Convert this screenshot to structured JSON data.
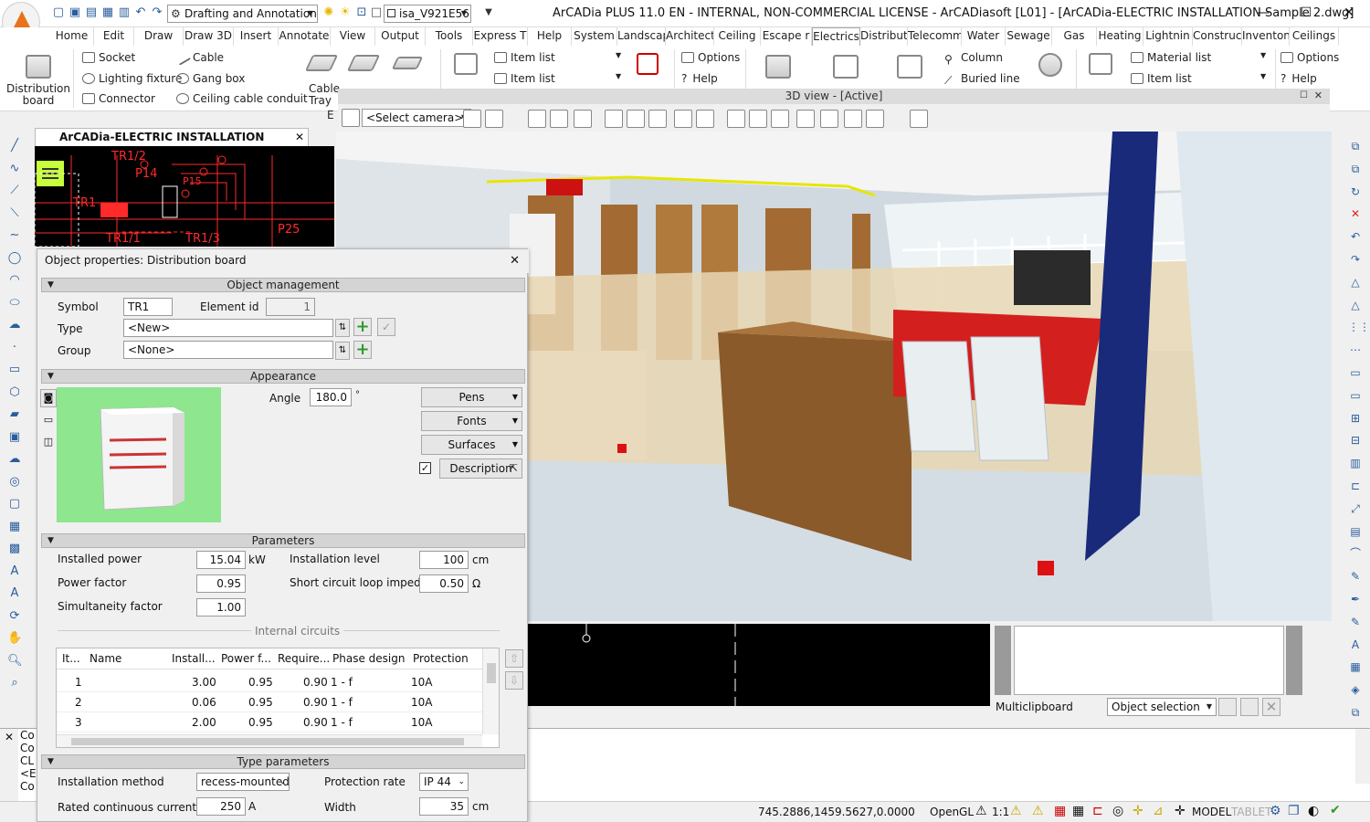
{
  "window": {
    "title": "ArCADia PLUS 11.0 EN - INTERNAL, NON-COMMERCIAL LICENSE - ArCADiasoft [L01] - [ArCADia-ELECTRIC INSTALLATION Sample 2.dwg]",
    "workspace": "Drafting and Annotation",
    "layer": "isa_V921E56"
  },
  "tabs": [
    "Home",
    "Edit",
    "Draw",
    "Draw 3D",
    "Insert",
    "Annotate",
    "View",
    "Output",
    "Tools",
    "Express T",
    "Help",
    "System",
    "Landscap",
    "Architect",
    "Ceiling",
    "Escape r",
    "Electrics",
    "Distribut",
    "Telecomm",
    "Water",
    "Sewage",
    "Gas",
    "Heating",
    "Lightnin",
    "Construc",
    "Inventon",
    "Ceilings"
  ],
  "active_tab": "Electrics",
  "ribbon": {
    "distribution_board": "Distribution board",
    "socket": "Socket",
    "lighting_fixture": "Lighting fixture",
    "connector": "Connector",
    "cable": "Cable",
    "gang_box": "Gang box",
    "ceiling_cable_conduit": "Ceiling cable conduit",
    "cable_tray": "Cable Tray",
    "item_list_1": "Item list",
    "item_list_2": "Item list",
    "options_1": "Options",
    "help_1": "Help",
    "column": "Column",
    "buried_line": "Buried line",
    "material_list": "Material list",
    "item_list_3": "Item list",
    "options_2": "Options",
    "help_2": "Help",
    "e_label": "E"
  },
  "doc_tab": "ArCADia-ELECTRIC INSTALLATION Sample 2.dwg",
  "view3d": {
    "title": "3D view - [Active]",
    "camera": "<Select camera>"
  },
  "drawing_labels": [
    "TR1/2",
    "P14",
    "P15",
    "TR1",
    "TR1/1",
    "TR1/3",
    "P25"
  ],
  "props": {
    "title": "Object properties: Distribution board",
    "sections": {
      "object_management": "Object management",
      "appearance": "Appearance",
      "parameters": "Parameters",
      "type_parameters": "Type parameters"
    },
    "symbol_label": "Symbol",
    "symbol_value": "TR1",
    "element_id_label": "Element id",
    "element_id_value": "1",
    "type_label": "Type",
    "type_value": "<New>",
    "group_label": "Group",
    "group_value": "<None>",
    "angle_label": "Angle",
    "angle_value": "180.0",
    "angle_unit": "°",
    "pens": "Pens",
    "fonts": "Fonts",
    "surfaces": "Surfaces",
    "description": "Description",
    "installed_power_label": "Installed power",
    "installed_power_value": "15.04",
    "installed_power_unit": "kW",
    "power_factor_label": "Power factor",
    "power_factor_value": "0.95",
    "simultaneity_label": "Simultaneity factor",
    "simultaneity_value": "1.00",
    "installation_level_label": "Installation level",
    "installation_level_value": "100",
    "installation_level_unit": "cm",
    "scli_label": "Short circuit loop impedance",
    "scli_value": "0.50",
    "scli_unit": "Ω",
    "internal_circuits": "Internal circuits",
    "grid_headers": [
      "It...",
      "Name",
      "Install...",
      "Power f...",
      "Require...",
      "Phase design",
      "Protection"
    ],
    "grid_rows": [
      {
        "item": "1",
        "name": "",
        "installed": "3.00",
        "pf": "0.95",
        "req": "0.90",
        "phase": "1 - f",
        "prot": "10A"
      },
      {
        "item": "2",
        "name": "",
        "installed": "0.06",
        "pf": "0.95",
        "req": "0.90",
        "phase": "1 - f",
        "prot": "10A"
      },
      {
        "item": "3",
        "name": "",
        "installed": "2.00",
        "pf": "0.95",
        "req": "0.90",
        "phase": "1 - f",
        "prot": "10A"
      }
    ],
    "installation_method_label": "Installation method",
    "installation_method_value": "recess-mounted",
    "protection_rate_label": "Protection rate",
    "protection_rate_value": "IP 44",
    "rated_current_label": "Rated continuous current",
    "rated_current_value": "250",
    "rated_current_unit": "A",
    "width_label": "Width",
    "width_value": "35",
    "width_unit": "cm"
  },
  "multiclipboard": {
    "label": "Multiclipboard",
    "selection": "Object selection"
  },
  "cmd_lines": [
    "Co",
    "Co",
    "CL",
    "<E",
    "Co"
  ],
  "status": {
    "coords": "745.2886,1459.5627,0.0000",
    "renderer": "OpenGL",
    "scale": "1:1",
    "model": "MODEL",
    "tablet": "TABLET"
  },
  "colors": {
    "accent": "#e8731c",
    "section_header": "#d4d4d4",
    "preview_bg": "#8ee68e",
    "drawing_red": "#ff2a2a"
  }
}
